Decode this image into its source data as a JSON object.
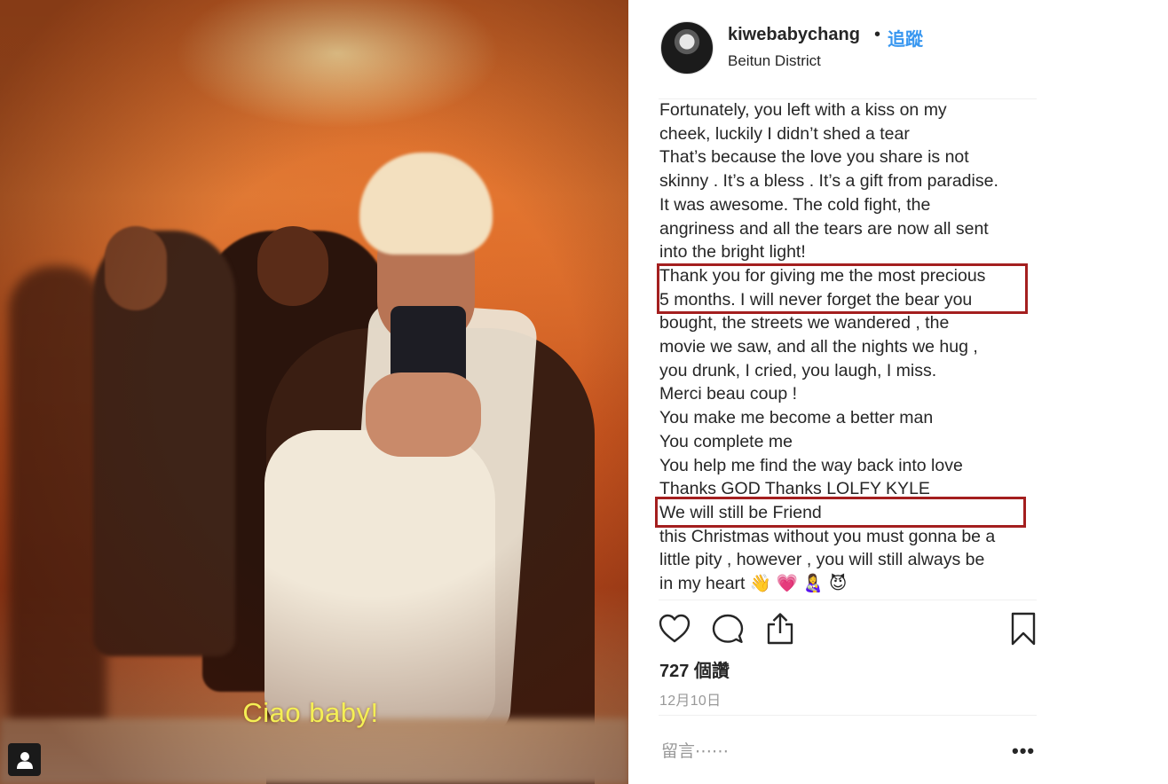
{
  "photo": {
    "subtitle": "Ciao baby!",
    "tag_icon": "person-tag-icon"
  },
  "header": {
    "username": "kiwebabychang",
    "separator": "•",
    "follow_label": "追蹤",
    "location": "Beitun District"
  },
  "caption": {
    "lines": [
      "Fortunately, you left with a kiss on my",
      "cheek, luckily I didn’t shed a tear",
      "That’s because the love you share is not",
      "skinny . It’s a bless . It’s a gift from paradise.",
      "It was awesome. The cold fight, the",
      "angriness and all the tears are now all sent",
      "into the bright light!",
      "Thank you for giving me the most precious",
      "5 months. I will never forget the bear you",
      "bought, the streets we wandered , the",
      "movie we saw, and all the nights we hug ,",
      "you drunk, I cried, you laugh, I miss.",
      "Merci beau coup !",
      "You make me become a better man",
      "You complete me",
      "You help me find the way back into love",
      "Thanks GOD Thanks LOLFY KYLE",
      "We will still be Friend",
      "this Christmas without you must gonna be a",
      "little pity , however , you will still always be",
      "in my heart 👋 💗 👩‍🍼 😈"
    ],
    "highlight_color": "#a41f1f"
  },
  "actions": {
    "like_icon": "heart-icon",
    "comment_icon": "comment-bubble-icon",
    "share_icon": "share-upload-icon",
    "save_icon": "bookmark-icon"
  },
  "stats": {
    "likes": "727 個讚",
    "date": "12月10日"
  },
  "comment": {
    "placeholder": "留言⋯⋯",
    "more_label": "•••"
  },
  "colors": {
    "link": "#3897f0",
    "text": "#262626",
    "muted": "#999999"
  }
}
